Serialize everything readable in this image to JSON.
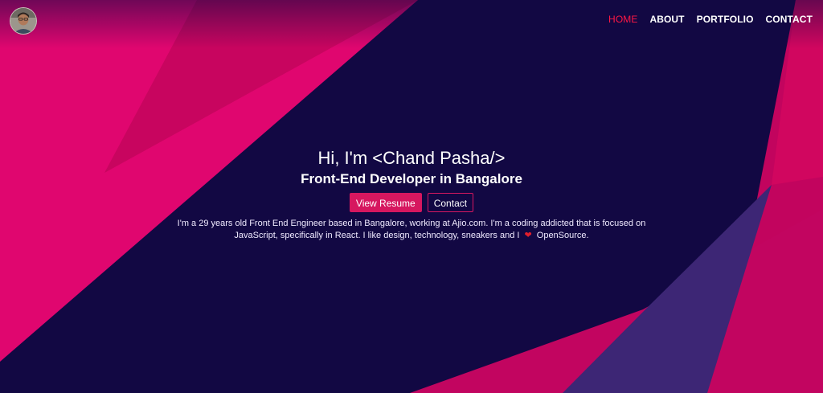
{
  "nav": {
    "home": "HOME",
    "about": "ABOUT",
    "portfolio": "PORTFOLIO",
    "contact": "CONTACT",
    "active_color": "#ff1744"
  },
  "hero": {
    "title": "Hi, I'm <Chand Pasha/>",
    "subtitle": "Front-End Developer in Bangalore",
    "resume_button": "View Resume",
    "contact_button": "Contact",
    "bio_part1": "I'm a 29 years old Front End Engineer based in Bangalore, working at Ajio.com. I'm a coding addicted that is focused on JavaScript, specifically in React. I like design, technology, sneakers and I",
    "heart_icon": "heart-icon",
    "bio_part2": "OpenSource."
  },
  "colors": {
    "background": "#120843",
    "pink": "#e0066f",
    "magenta": "#c2045e",
    "purple": "#3a2574",
    "button": "#d6175f"
  }
}
